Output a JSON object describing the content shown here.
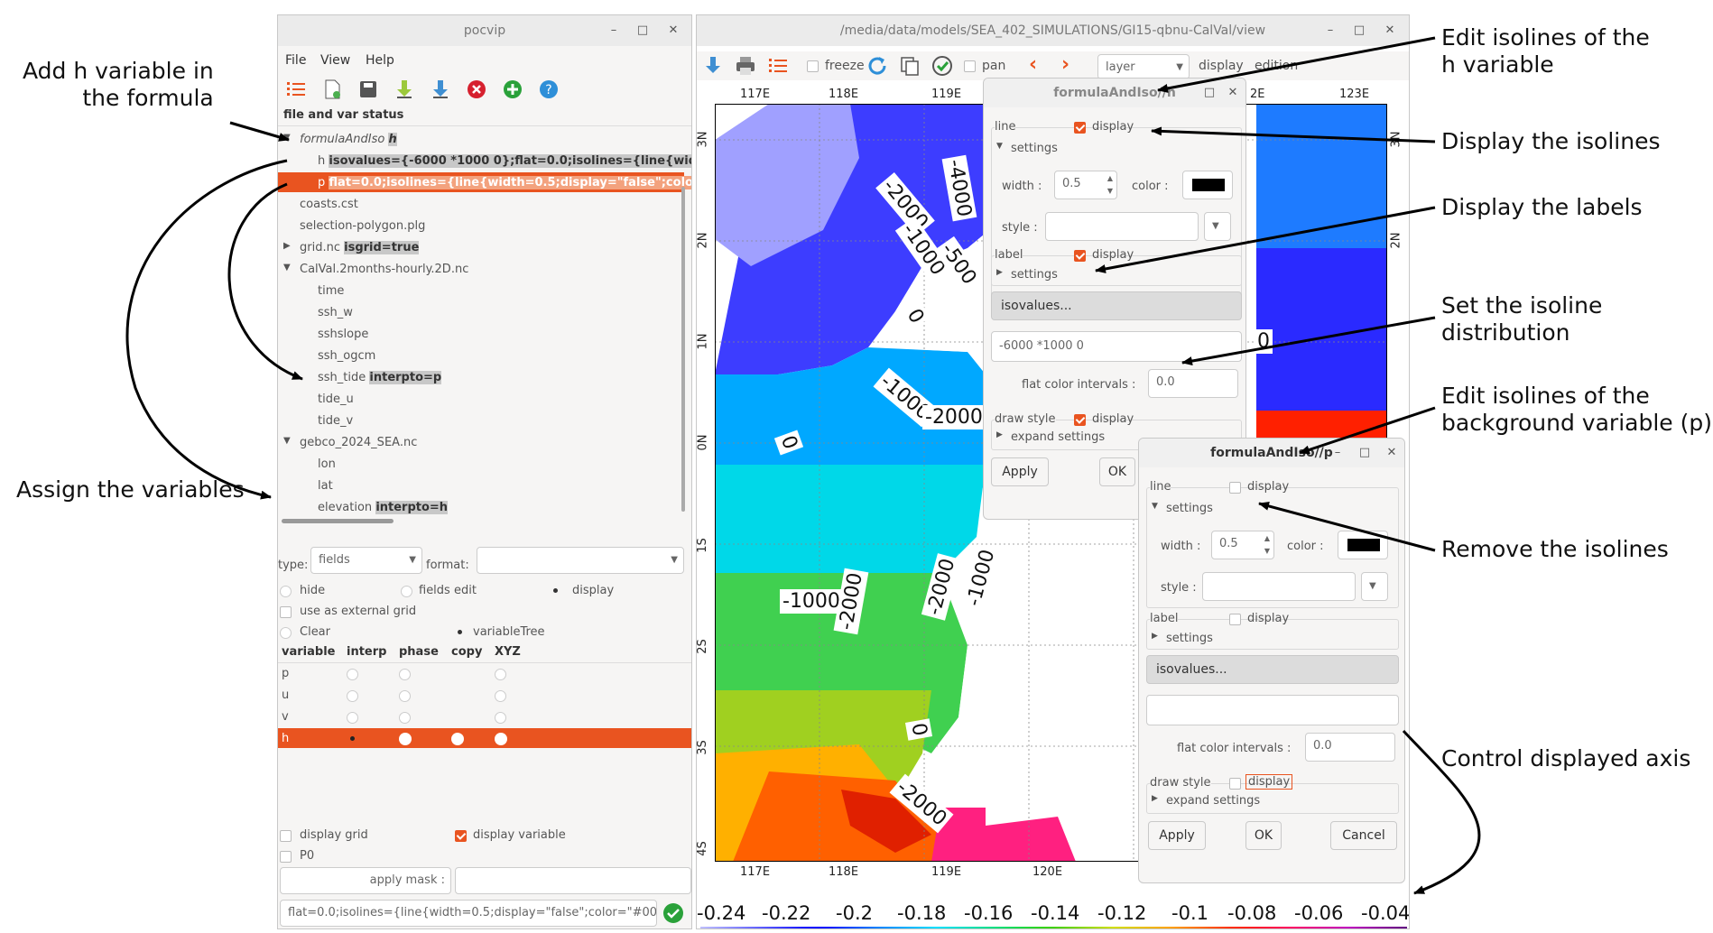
{
  "annotations": {
    "add_h": "Add h variable in\n the formula",
    "assign": "Assign the variables",
    "edit_iso_h": "Edit isolines of the\nh variable",
    "display_isolines": "Display the isolines",
    "display_labels": "Display the labels",
    "set_distribution": "Set the isoline\ndistribution",
    "edit_iso_bg": "Edit isolines of the\nbackground variable (p)",
    "remove_isolines": "Remove the isolines",
    "control_axis": "Control displayed axis"
  },
  "left_window": {
    "title": "pocvip",
    "menu": [
      "File",
      "View",
      "Help"
    ],
    "tree_header": "file and var status",
    "tree": [
      {
        "label": "formulaAndIso",
        "tag": "h"
      },
      {
        "label": "h",
        "tag": "isovalues={-6000 *1000 0};flat=0.0;isolines={line{width=0."
      },
      {
        "label": "p",
        "tag": "flat=0.0;isolines={line{width=0.5;display=\"false\";color=\""
      },
      {
        "label": "coasts.cst",
        "tag": ""
      },
      {
        "label": "selection-polygon.plg",
        "tag": ""
      },
      {
        "label": "grid.nc",
        "tag": "isgrid=true"
      },
      {
        "label": "CalVal.2months-hourly.2D.nc",
        "tag": ""
      },
      {
        "label": "time",
        "tag": ""
      },
      {
        "label": "ssh_w",
        "tag": ""
      },
      {
        "label": "sshslope",
        "tag": ""
      },
      {
        "label": "ssh_ogcm",
        "tag": ""
      },
      {
        "label": "ssh_tide",
        "tag": "interpto=p"
      },
      {
        "label": "tide_u",
        "tag": ""
      },
      {
        "label": "tide_v",
        "tag": ""
      },
      {
        "label": "gebco_2024_SEA.nc",
        "tag": ""
      },
      {
        "label": "lon",
        "tag": ""
      },
      {
        "label": "lat",
        "tag": ""
      },
      {
        "label": "elevation",
        "tag": "interpto=h"
      }
    ],
    "type_label": "type:",
    "type_value": "fields",
    "format_label": "format:",
    "radio_hide": "hide",
    "radio_fields_edit": "fields edit",
    "radio_display": "display",
    "use_external_grid": "use as external grid",
    "radio_clear": "Clear",
    "radio_variable_tree": "variableTree",
    "table_headers": [
      "variable",
      "interp",
      "phase",
      "copy",
      "XYZ"
    ],
    "table_rows": [
      "p",
      "u",
      "v",
      "h"
    ],
    "display_grid": "display grid",
    "display_variable": "display variable",
    "p0": "P0",
    "apply_mask": "apply mask :",
    "formula_value": "flat=0.0;isolines={line{width=0.5;display=\"false\";color=\"#000"
  },
  "map_window": {
    "title": "/media/data/models/SEA_402_SIMULATIONS/GI15-qbnu-CalVal/view",
    "toolbar": {
      "freeze": "freeze",
      "pan": "pan",
      "layer": "layer",
      "display": "display",
      "edition": "edition"
    },
    "top_ticks": [
      "117E",
      "118E",
      "119E",
      "2E",
      "123E"
    ],
    "bottom_ticks": [
      "117E",
      "118E",
      "119E",
      "120E"
    ],
    "left_ticks": [
      "3N",
      "2N",
      "1N",
      "0N",
      "1S",
      "2S",
      "3S",
      "4S"
    ],
    "right_ticks": [
      "3N",
      "2N"
    ],
    "isoline_labels": [
      "-4000",
      "-2000",
      "-1000",
      "-500",
      "0",
      "-1000",
      "-2000",
      "0",
      "-1000",
      "-2000",
      "-2000",
      "-1000",
      "0",
      "-2000",
      "0"
    ],
    "colorbar_ticks": [
      "-0.24",
      "-0.22",
      "-0.2",
      "-0.18",
      "-0.16",
      "-0.14",
      "-0.12",
      "-0.1",
      "-0.08",
      "-0.06",
      "-0.04"
    ]
  },
  "dialog_h": {
    "title": "formulaAndIso//h",
    "line": "line",
    "display": "display",
    "settings": "settings",
    "width_label": "width :",
    "width_value": "0.5",
    "color_label": "color :",
    "style_label": "style :",
    "label": "label",
    "isovalues_button": "isovalues...",
    "isovalues_value": "-6000 *1000 0",
    "flat_label": "flat color intervals :",
    "flat_value": "0.0",
    "draw_style": "draw style",
    "expand_settings": "expand settings",
    "apply": "Apply",
    "ok": "OK"
  },
  "dialog_p": {
    "title": "formulaAndIso//p",
    "line": "line",
    "display": "display",
    "settings": "settings",
    "width_label": "width :",
    "width_value": "0.5",
    "color_label": "color :",
    "style_label": "style :",
    "label": "label",
    "isovalues_button": "isovalues...",
    "isovalues_value": "",
    "flat_label": "flat color intervals :",
    "flat_value": "0.0",
    "draw_style": "draw style",
    "expand_settings": "expand settings",
    "apply": "Apply",
    "ok": "OK",
    "cancel": "Cancel"
  },
  "colors": {
    "accent": "#e95420",
    "highlight": "#c8c8c8",
    "line_color": "#000000"
  }
}
